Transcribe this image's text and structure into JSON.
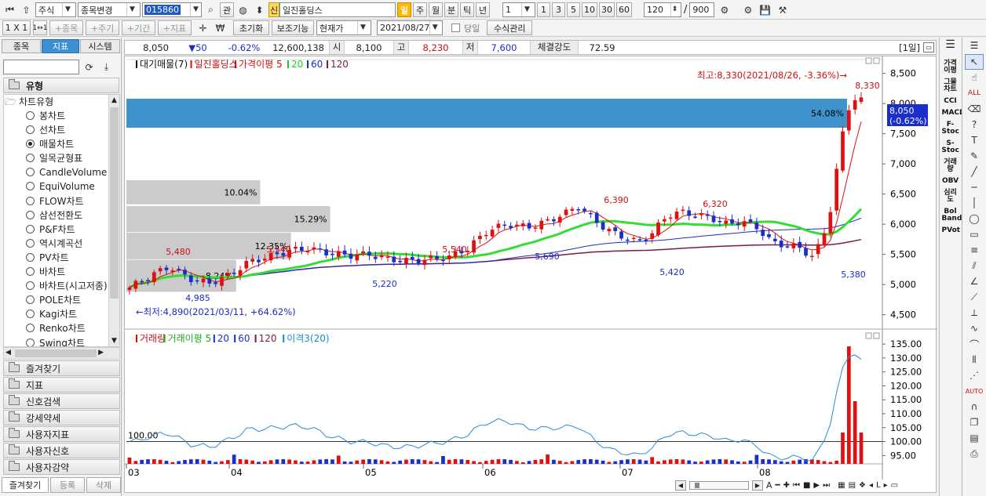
{
  "toolbar1": {
    "market": "주식",
    "code_change": "종목변경",
    "code": "015860",
    "rel": "관",
    "badge_new": "신",
    "name": "일진홀딩스",
    "periods": [
      "일",
      "주",
      "월",
      "분",
      "틱",
      "년"
    ],
    "period_active": "일",
    "unit_value": "1",
    "unit_options": [
      "1",
      "3",
      "5",
      "10",
      "30",
      "60"
    ],
    "count": "120",
    "slash": "/",
    "total": "900"
  },
  "toolbar2": {
    "layout": "1 X 1",
    "layout2": "1↔1",
    "greyed": [
      "+종목",
      "+주기",
      "+기간",
      "+지표"
    ],
    "reset": "초기화",
    "aux": "보조기능",
    "price_type": "현재가",
    "date": "2021/08/27",
    "today_label": "당일",
    "formula": "수식관리"
  },
  "left": {
    "tabs": [
      "종목",
      "지표",
      "시스템"
    ],
    "active_tab": "지표",
    "group_label": "유형",
    "tree_root": "차트유형",
    "items": [
      "봉차트",
      "선차트",
      "매물차트",
      "일목균형표",
      "CandleVolume",
      "EquiVolume",
      "FLOW차트",
      "삼선전환도",
      "P&F차트",
      "역시계곡선",
      "PV차트",
      "바차트",
      "바차트(시고저종)",
      "POLE차트",
      "Kagi차트",
      "Renko차트",
      "Swing차트"
    ],
    "selected_item": "매물차트",
    "categories": [
      "즐겨찾기",
      "지표",
      "신호검색",
      "강세약세",
      "사용자지표",
      "사용자신호",
      "사용자강약"
    ],
    "bottom_tabs": [
      "즐겨찾기",
      "등록",
      "삭제"
    ]
  },
  "quote": {
    "price": "8,050",
    "change": "▼50",
    "rate": "-0.62%",
    "volume": "12,600,138",
    "open_label": "시",
    "open": "8,100",
    "high_label": "고",
    "high": "8,230",
    "low_label": "저",
    "low": "7,600",
    "strength_label": "체결강도",
    "strength": "72.59",
    "period_tag": "[1일]"
  },
  "price_panel": {
    "legend": [
      {
        "text": "대기매물(7)",
        "color": "#111111"
      },
      {
        "text": "일진홀딩스",
        "color": "#d01010"
      },
      {
        "text": "가격이평 5",
        "color": "#d01010"
      },
      {
        "text": "20",
        "color": "#22cc22"
      },
      {
        "text": "60",
        "color": "#1a2ec8"
      },
      {
        "text": "120",
        "color": "#7a1a4a"
      }
    ],
    "high_note": "최고:8,330(2021/08/26, -3.36%)→",
    "low_note": "←최저:4,890(2021/03/11, +64.62%)",
    "current_label_1": "8,050",
    "current_label_2": "(-0.62%)",
    "y_ticks": [
      "8,500",
      "8,000",
      "7,500",
      "7,000",
      "6,500",
      "6,000",
      "5,500",
      "5,000",
      "4,500"
    ],
    "annotations": [
      "8,330",
      "5,480",
      "5,540",
      "5,540",
      "6,390",
      "6,320",
      "4,985",
      "5,220",
      "5,690",
      "5,420",
      "5,380"
    ],
    "volume_profile": [
      {
        "pct": "54.08%",
        "share": 54.08,
        "highlight": true
      },
      {
        "pct": "10.04%",
        "share": 10.04,
        "highlight": false
      },
      {
        "pct": "15.29%",
        "share": 15.29,
        "highlight": false
      },
      {
        "pct": "12.35%",
        "share": 12.35,
        "highlight": false
      },
      {
        "pct": "8.24%",
        "share": 8.24,
        "highlight": false
      }
    ]
  },
  "volume_panel": {
    "legend": [
      {
        "text": "거래량",
        "color": "#d01010"
      },
      {
        "text": "거래이평 5",
        "color": "#22aa22"
      },
      {
        "text": "20",
        "color": "#1a2ec8"
      },
      {
        "text": "60",
        "color": "#1a2ec8"
      },
      {
        "text": "120",
        "color": "#7a1a4a"
      },
      {
        "text": "이격3(20)",
        "color": "#1a8ad0"
      }
    ],
    "ref_label": "100.00",
    "y_ticks": [
      "135.00",
      "130.00",
      "125.00",
      "120.00",
      "115.00",
      "110.00",
      "105.00",
      "100.00",
      "95.00"
    ]
  },
  "x_ticks": [
    "03",
    "04",
    "05",
    "06",
    "07",
    "08"
  ],
  "right_tools": [
    "가격이평",
    "그물차트",
    "CCI",
    "MACD",
    "F-Stoc",
    "S-Stoc",
    "거래량",
    "OBV",
    "심리도",
    "Bol Band",
    "PVot"
  ],
  "colors": {
    "up": "#e01010",
    "down": "#1a2ec8",
    "ma20": "#33dd33",
    "ma60": "#1a2ec8",
    "ma120": "#7a1a4a",
    "profile_hi": "#3f93cc",
    "profile": "#c8c8c8",
    "disparity": "#2a8ad8"
  }
}
